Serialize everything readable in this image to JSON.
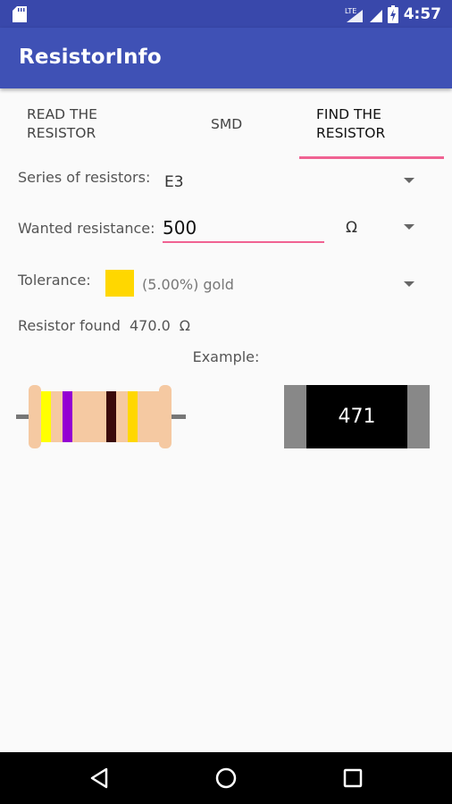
{
  "status_bar": {
    "time": "4:57",
    "icons": [
      "sd-card-icon",
      "lte-signal-icon",
      "wifi-signal-icon",
      "battery-charging-icon"
    ]
  },
  "app_bar": {
    "title": "ResistorInfo"
  },
  "tabs": [
    {
      "line1": "READ THE",
      "line2": "RESISTOR",
      "active": false
    },
    {
      "line1": "SMD",
      "line2": "",
      "active": false
    },
    {
      "line1": "FIND THE",
      "line2": "RESISTOR",
      "active": true
    }
  ],
  "series": {
    "label": "Series of resistors:",
    "value": "E3"
  },
  "wanted": {
    "label": "Wanted resistance:",
    "value": "500",
    "unit": "Ω"
  },
  "tolerance": {
    "label": "Tolerance:",
    "value": "(5.00%) gold",
    "swatch_color": "#ffd700"
  },
  "found": {
    "label": "Resistor found",
    "value": "470.0",
    "unit": "Ω"
  },
  "example": {
    "label": "Example:",
    "bands": [
      {
        "color": "#ffff00",
        "name": "yellow"
      },
      {
        "color": "#9400d3",
        "name": "violet"
      },
      {
        "color": "#3b0a0a",
        "name": "brown"
      },
      {
        "color": "#ffd700",
        "name": "gold"
      }
    ],
    "body_color": "#f5c9a2",
    "smd_code": "471"
  },
  "colors": {
    "primary": "#3f51b5",
    "primary_dark": "#3948ab",
    "accent": "#f06292"
  }
}
